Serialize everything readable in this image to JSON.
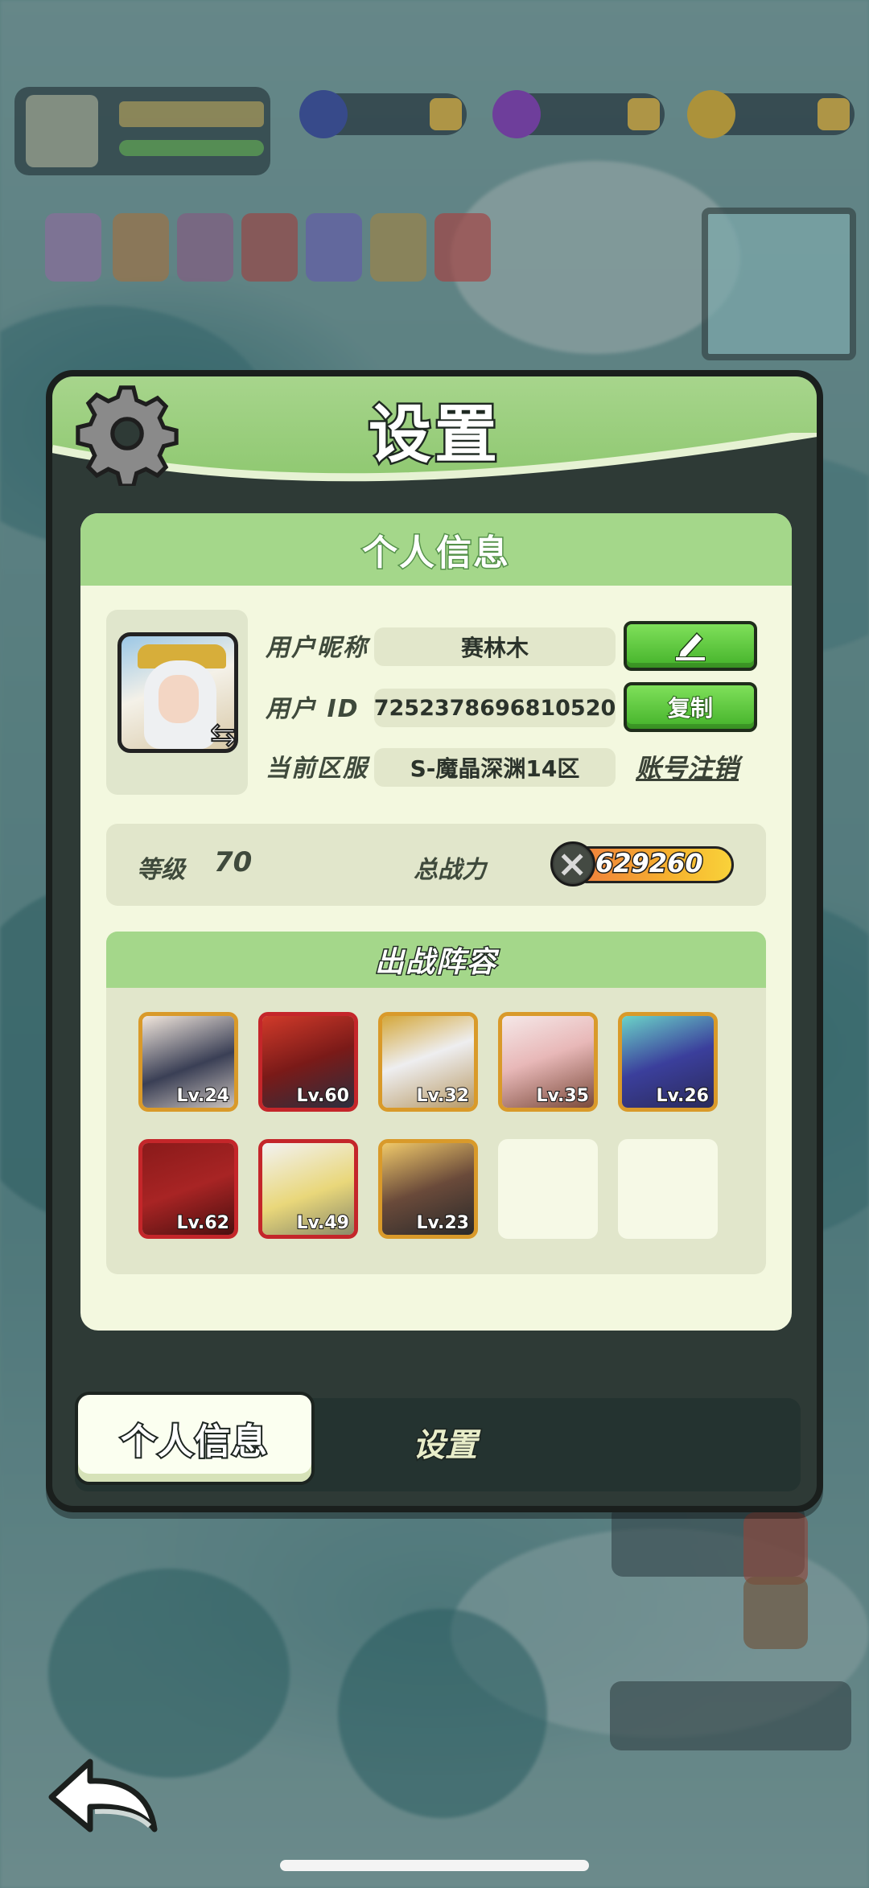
{
  "panel": {
    "title": "设置",
    "section_title": "个人信息"
  },
  "profile": {
    "nickname_label": "用户昵称",
    "nickname": "赛林木",
    "id_label": "用户  ID",
    "user_id": "7252378696810520",
    "server_label": "当前区服",
    "server": "S-魔晶深渊14区",
    "edit_icon": "pencil-icon",
    "copy_label": "复制",
    "delete_label": "账号注销"
  },
  "stats": {
    "level_label": "等级",
    "level": "70",
    "power_label": "总战力",
    "power": "629260"
  },
  "lineup": {
    "title": "出战阵容",
    "heroes": [
      {
        "level": "Lv.24",
        "frame": "gold"
      },
      {
        "level": "Lv.60",
        "frame": "red"
      },
      {
        "level": "Lv.32",
        "frame": "gold"
      },
      {
        "level": "Lv.35",
        "frame": "gold"
      },
      {
        "level": "Lv.26",
        "frame": "gold"
      },
      {
        "level": "Lv.62",
        "frame": "red"
      },
      {
        "level": "Lv.49",
        "frame": "red"
      },
      {
        "level": "Lv.23",
        "frame": "gold"
      }
    ],
    "empty_slots": 2
  },
  "tabs": {
    "active": "个人信息",
    "other": "设置"
  },
  "colors": {
    "accent_green": "#8bc66c",
    "button_green": "#44b22a",
    "card_bg": "#f3f8df",
    "frame_gold": "#d99a2a",
    "frame_red": "#c4262a"
  }
}
